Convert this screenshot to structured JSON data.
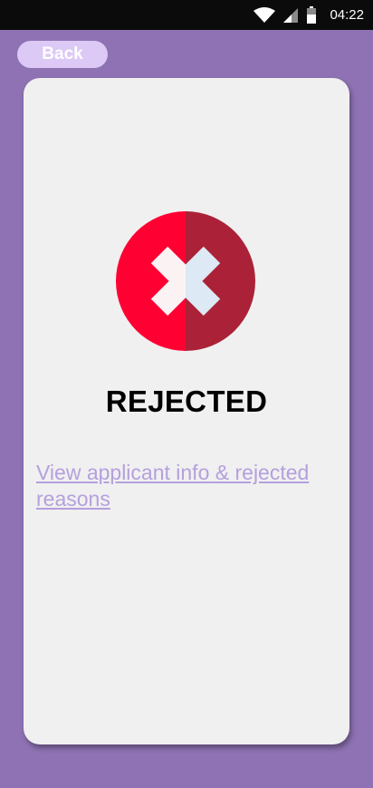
{
  "status_bar": {
    "time": "04:22",
    "icons": [
      "wifi-icon",
      "signal-icon",
      "battery-icon"
    ]
  },
  "header": {
    "back_label": "Back"
  },
  "result": {
    "status_label": "REJECTED",
    "icon": "rejected-x-circle-icon",
    "link_text": "View applicant info & rejected reasons"
  },
  "colors": {
    "background": "#8e72b3",
    "card": "#f0f0f0",
    "back_button": "#dcc9f6",
    "reject_left": "#ff0033",
    "reject_right": "#ab2238",
    "link": "#b5a0dd"
  }
}
